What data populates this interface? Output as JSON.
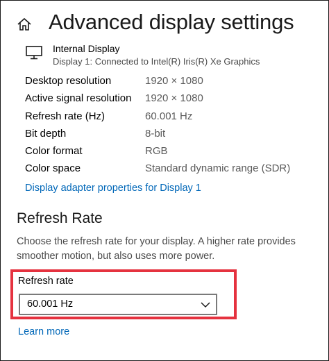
{
  "header": {
    "title": "Advanced display settings",
    "home_icon": "home-icon"
  },
  "display": {
    "icon": "monitor-icon",
    "name": "Internal Display",
    "connection": "Display 1: Connected to Intel(R) Iris(R) Xe Graphics"
  },
  "info": {
    "rows": [
      {
        "label": "Desktop resolution",
        "value": "1920 × 1080"
      },
      {
        "label": "Active signal resolution",
        "value": "1920 × 1080"
      },
      {
        "label": "Refresh rate (Hz)",
        "value": "60.001 Hz"
      },
      {
        "label": "Bit depth",
        "value": "8-bit"
      },
      {
        "label": "Color format",
        "value": "RGB"
      },
      {
        "label": "Color space",
        "value": "Standard dynamic range (SDR)"
      }
    ]
  },
  "links": {
    "adapter_properties": "Display adapter properties for Display 1",
    "learn_more": "Learn more"
  },
  "refresh_section": {
    "title": "Refresh Rate",
    "description": "Choose the refresh rate for your display. A higher rate provides smoother motion, but also uses more power.",
    "field_label": "Refresh rate",
    "selected_value": "60.001 Hz",
    "dropdown_icon": "chevron-down-icon"
  },
  "colors": {
    "link": "#0067b8",
    "highlight": "#e5323f",
    "secondary_text": "#5a5a5a"
  }
}
